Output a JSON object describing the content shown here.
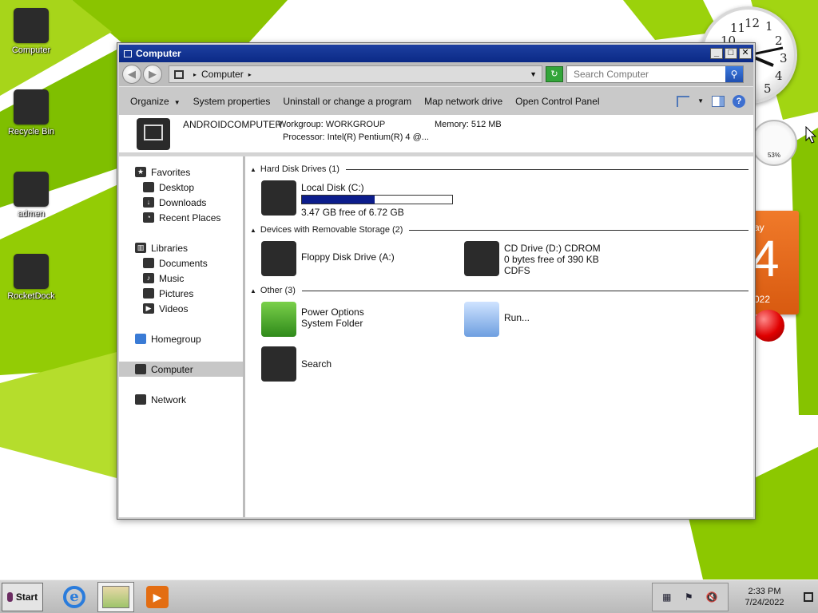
{
  "desktop": {
    "icons": [
      {
        "label": "Computer"
      },
      {
        "label": "Recycle Bin"
      },
      {
        "label": "admen"
      },
      {
        "label": "RocketDock"
      }
    ],
    "gadgets": {
      "clock_numbers": [
        "10",
        "11",
        "12",
        "1",
        "2",
        "3",
        "4",
        "5"
      ],
      "meter_percent": "53%",
      "calendar": {
        "day_fragment": "ay",
        "date_fragment": "4",
        "year_fragment": "022"
      }
    }
  },
  "window": {
    "title": "Computer",
    "titlebar_buttons": {
      "minimize": "_",
      "maximize": "□",
      "close": "✕"
    },
    "address": {
      "path_root": "Computer",
      "separator": "▸"
    },
    "search": {
      "placeholder": "Search Computer"
    },
    "command_bar": {
      "organize": "Organize",
      "system_properties": "System properties",
      "uninstall": "Uninstall or change a program",
      "map_drive": "Map network drive",
      "control_panel": "Open Control Panel"
    },
    "details": {
      "name": "ANDROIDCOMPUTER",
      "workgroup": "Workgroup: WORKGROUP",
      "memory": "Memory: 512 MB",
      "processor": "Processor: Intel(R) Pentium(R) 4  @..."
    },
    "nav": {
      "favorites": "Favorites",
      "desktop": "Desktop",
      "downloads": "Downloads",
      "recent": "Recent Places",
      "libraries": "Libraries",
      "documents": "Documents",
      "music": "Music",
      "pictures": "Pictures",
      "videos": "Videos",
      "homegroup": "Homegroup",
      "computer": "Computer",
      "network": "Network"
    },
    "groups": {
      "hdd": "Hard Disk Drives (1)",
      "removable": "Devices with Removable Storage (2)",
      "other": "Other (3)"
    },
    "items": {
      "local_disk": {
        "name": "Local Disk (C:)",
        "free": "3.47 GB free of 6.72 GB",
        "used_fraction": 0.484
      },
      "floppy": {
        "name": "Floppy Disk Drive (A:)"
      },
      "cd": {
        "name": "CD Drive (D:) CDROM",
        "free": "0 bytes free of 390 KB",
        "fs": "CDFS"
      },
      "power": {
        "name": "Power Options",
        "sub": "System Folder"
      },
      "run": {
        "name": "Run..."
      },
      "search": {
        "name": "Search"
      }
    }
  },
  "taskbar": {
    "start": "Start",
    "time": "2:33 PM",
    "date": "7/24/2022"
  }
}
